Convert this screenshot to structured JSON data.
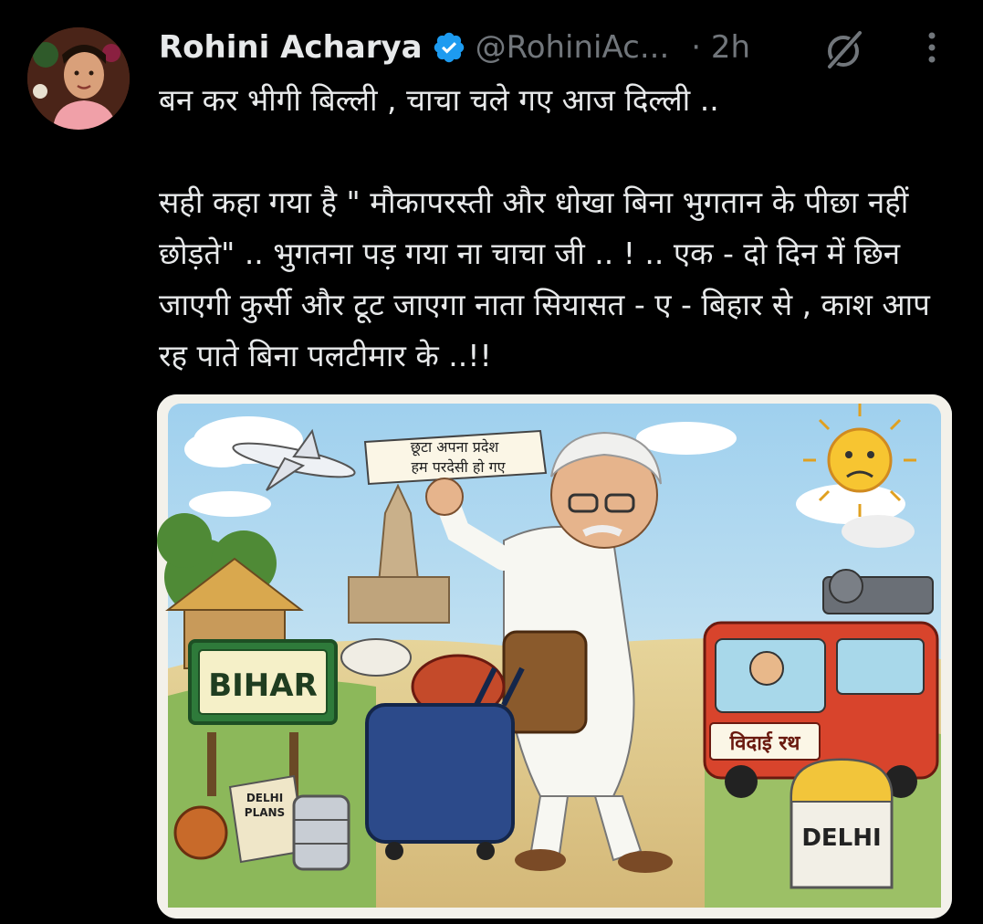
{
  "author": {
    "name": "Rohini Acharya",
    "handle": "@RohiniAc...",
    "time": "· 2h"
  },
  "tweet": {
    "line1": "बन कर भीगी बिल्ली , चाचा चले गए आज दिल्ली ..",
    "paragraph2": "सही कहा गया है \" मौकापरस्ती और धोखा बिना भुगतान के पीछा नहीं छोड़ते\" .. भुगतना पड़ गया ना चाचा जी .. ! .. एक - दो दिन में छिन जाएगी कुर्सी और टूट जाएगा नाता सियासत - ए - बिहार से , काश आप रह पाते बिना पलटीमार के ..!!"
  },
  "image": {
    "banner_line1": "छूटा अपना प्रदेश",
    "banner_line2": "हम परदेसी हो गए",
    "sign_bihar": "BIHAR",
    "bus_sign": "विदाई रथ",
    "milestone": "DELHI",
    "map_line1": "DELHI",
    "map_line2": "PLANS"
  },
  "icons": {
    "verified": "verified-badge-icon",
    "grok": "grok-icon",
    "more": "more-vertical-icon"
  },
  "colors": {
    "verified": "#1d9bf0",
    "secondary_text": "#71767b"
  }
}
